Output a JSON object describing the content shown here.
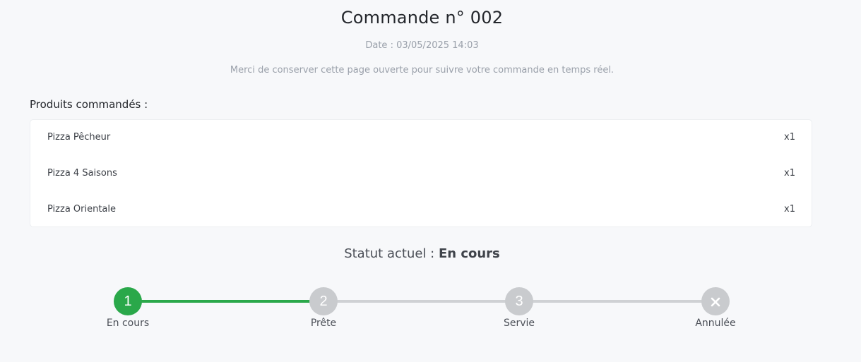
{
  "order": {
    "title": "Commande n° 002",
    "date_label": "Date :",
    "date_value": "03/05/2025 14:03",
    "notice": "Merci de conserver cette page ouverte pour suivre votre commande en temps réel."
  },
  "products": {
    "heading": "Produits commandés :",
    "items": [
      {
        "name": "Pizza Pêcheur",
        "qty": "x1"
      },
      {
        "name": "Pizza 4 Saisons",
        "qty": "x1"
      },
      {
        "name": "Pizza Orientale",
        "qty": "x1"
      }
    ]
  },
  "status": {
    "label": "Statut actuel :",
    "value": "En cours"
  },
  "steps": [
    {
      "number": "1",
      "label": "En cours",
      "state": "active"
    },
    {
      "number": "2",
      "label": "Prête",
      "state": "pending"
    },
    {
      "number": "3",
      "label": "Servie",
      "state": "pending"
    },
    {
      "number": "",
      "label": "Annulée",
      "state": "pending",
      "icon": "close-icon"
    }
  ],
  "colors": {
    "active": "#2aa84a",
    "inactive": "#c9cbce",
    "background": "#f7f8fa"
  }
}
